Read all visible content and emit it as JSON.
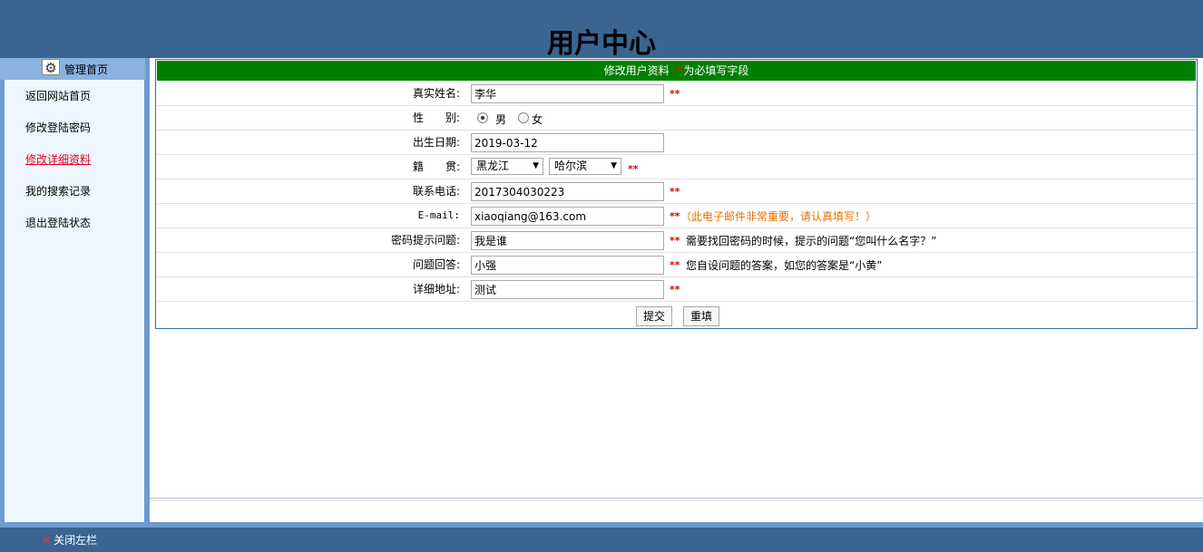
{
  "header": {
    "title": "用户中心"
  },
  "sidebar": {
    "head_label": "管理首页",
    "items": [
      {
        "label": "返回网站首页"
      },
      {
        "label": "修改登陆密码"
      },
      {
        "label": "修改详细资料"
      },
      {
        "label": "我的搜索记录"
      },
      {
        "label": "退出登陆状态"
      }
    ]
  },
  "form": {
    "title": "修改用户资料",
    "title_stars": "**",
    "title_note": "为必填写字段",
    "fields": {
      "name": {
        "label": "真实姓名:",
        "value": "李华",
        "req": "**"
      },
      "gender": {
        "label": "性　　别:",
        "options": [
          "男",
          "女"
        ],
        "selected": "男"
      },
      "birth": {
        "label": "出生日期:",
        "value": "2019-03-12"
      },
      "origin": {
        "label": "籍　　贯:",
        "province": "黑龙江",
        "city": "哈尔滨",
        "req": "**"
      },
      "phone": {
        "label": "联系电话:",
        "value": "2017304030223",
        "req": "**"
      },
      "email": {
        "label": "E-mail:",
        "value": "xiaoqiang@163.com",
        "req": "**",
        "hint": "（此电子邮件非常重要，请认真填写！）"
      },
      "question": {
        "label": "密码提示问题:",
        "value": "我是谁",
        "req": "**",
        "hint": "需要找回密码的时候，提示的问题“您叫什么名字？”"
      },
      "answer": {
        "label": "问题回答:",
        "value": "小强",
        "req": "**",
        "hint": "您自设问题的答案，如您的答案是“小黄”"
      },
      "address": {
        "label": "详细地址:",
        "value": "测试",
        "req": "**"
      }
    },
    "submit_label": "提交",
    "reset_label": "重填"
  },
  "footer": {
    "close_icon": "✕",
    "close_label": "关闭左栏"
  },
  "colors": {
    "topbar": "#3a6591",
    "form_header": "#008000",
    "required": "#e00000",
    "active_link": "#e0001a"
  }
}
